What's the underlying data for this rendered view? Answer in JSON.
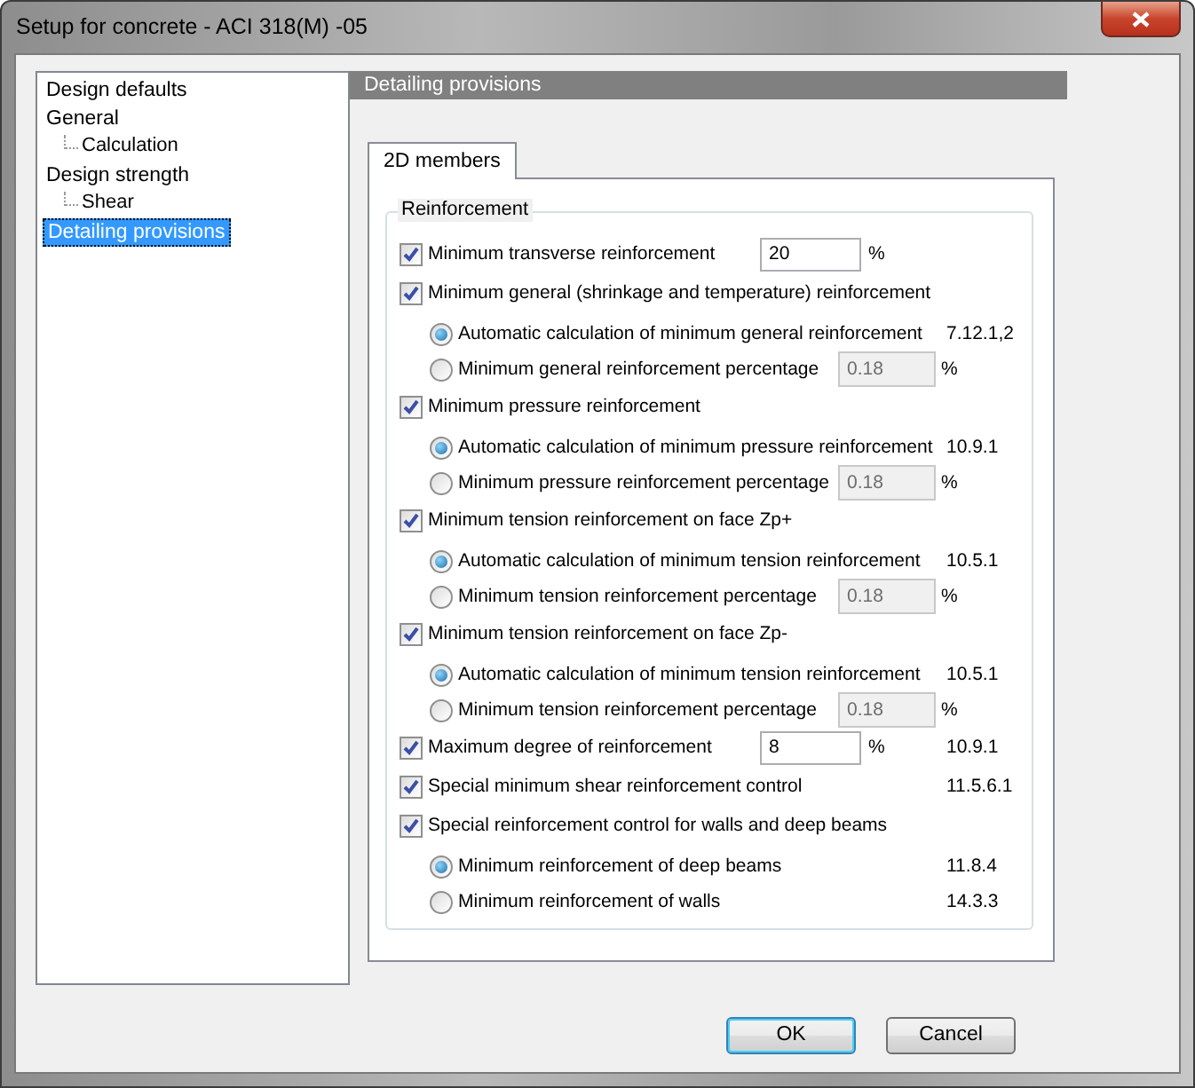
{
  "window": {
    "title": "Setup for concrete - ACI 318(M) -05"
  },
  "tree": [
    {
      "label": "Design defaults",
      "selected": false
    },
    {
      "label": "General",
      "selected": false,
      "children": [
        {
          "label": "Calculation",
          "selected": false
        }
      ]
    },
    {
      "label": "Design strength",
      "selected": false,
      "children": [
        {
          "label": "Shear",
          "selected": false
        }
      ]
    },
    {
      "label": "Detailing provisions",
      "selected": true
    }
  ],
  "panel": {
    "title": "Detailing provisions"
  },
  "tabs": [
    {
      "label": "2D members",
      "selected": true
    }
  ],
  "group": {
    "title": "Reinforcement"
  },
  "options": [
    {
      "kind": "check",
      "label": "Minimum transverse reinforcement",
      "checked": true,
      "value": "20",
      "unit": "%"
    },
    {
      "kind": "check",
      "label": "Minimum general (shrinkage and temperature) reinforcement",
      "checked": true
    },
    {
      "kind": "radio",
      "label": "Automatic calculation of minimum general reinforcement",
      "selected": true,
      "ref": "7.12.1,2"
    },
    {
      "kind": "radio",
      "label": "Minimum general reinforcement percentage",
      "selected": false,
      "value": "0.18",
      "disabled": true,
      "unit": "%"
    },
    {
      "kind": "check",
      "label": "Minimum pressure reinforcement",
      "checked": true
    },
    {
      "kind": "radio",
      "label": "Automatic calculation of minimum pressure reinforcement",
      "selected": true,
      "ref": "10.9.1"
    },
    {
      "kind": "radio",
      "label": "Minimum pressure reinforcement percentage",
      "selected": false,
      "value": "0.18",
      "disabled": true,
      "unit": "%"
    },
    {
      "kind": "check",
      "label": "Minimum tension reinforcement on face Zp+",
      "checked": true
    },
    {
      "kind": "radio",
      "label": "Automatic calculation of minimum tension reinforcement",
      "selected": true,
      "ref": "10.5.1"
    },
    {
      "kind": "radio",
      "label": "Minimum tension reinforcement percentage",
      "selected": false,
      "value": "0.18",
      "disabled": true,
      "unit": "%"
    },
    {
      "kind": "check",
      "label": "Minimum tension reinforcement on face Zp-",
      "checked": true
    },
    {
      "kind": "radio",
      "label": "Automatic calculation of minimum tension reinforcement",
      "selected": true,
      "ref": "10.5.1"
    },
    {
      "kind": "radio",
      "label": "Minimum tension reinforcement percentage",
      "selected": false,
      "value": "0.18",
      "disabled": true,
      "unit": "%"
    },
    {
      "kind": "check",
      "label": "Maximum degree of reinforcement",
      "checked": true,
      "value": "8",
      "unit": "%",
      "ref": "10.9.1"
    },
    {
      "kind": "check",
      "label": "Special minimum shear reinforcement control",
      "checked": true,
      "ref": "11.5.6.1"
    },
    {
      "kind": "check",
      "label": "Special reinforcement control for walls and deep beams",
      "checked": true
    },
    {
      "kind": "radio",
      "label": "Minimum reinforcement of deep beams",
      "selected": true,
      "ref": "11.8.4"
    },
    {
      "kind": "radio",
      "label": "Minimum reinforcement of walls",
      "selected": false,
      "ref": "14.3.3"
    }
  ],
  "buttons": [
    {
      "label": "OK",
      "default": true
    },
    {
      "label": "Cancel",
      "default": false
    }
  ]
}
